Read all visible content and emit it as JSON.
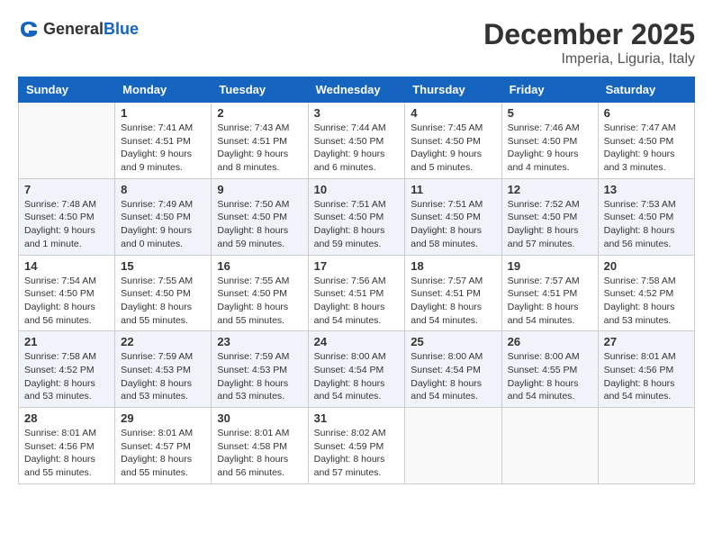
{
  "header": {
    "logo_general": "General",
    "logo_blue": "Blue",
    "month_title": "December 2025",
    "location": "Imperia, Liguria, Italy"
  },
  "columns": [
    "Sunday",
    "Monday",
    "Tuesday",
    "Wednesday",
    "Thursday",
    "Friday",
    "Saturday"
  ],
  "weeks": [
    [
      {
        "day": "",
        "info": ""
      },
      {
        "day": "1",
        "info": "Sunrise: 7:41 AM\nSunset: 4:51 PM\nDaylight: 9 hours\nand 9 minutes."
      },
      {
        "day": "2",
        "info": "Sunrise: 7:43 AM\nSunset: 4:51 PM\nDaylight: 9 hours\nand 8 minutes."
      },
      {
        "day": "3",
        "info": "Sunrise: 7:44 AM\nSunset: 4:50 PM\nDaylight: 9 hours\nand 6 minutes."
      },
      {
        "day": "4",
        "info": "Sunrise: 7:45 AM\nSunset: 4:50 PM\nDaylight: 9 hours\nand 5 minutes."
      },
      {
        "day": "5",
        "info": "Sunrise: 7:46 AM\nSunset: 4:50 PM\nDaylight: 9 hours\nand 4 minutes."
      },
      {
        "day": "6",
        "info": "Sunrise: 7:47 AM\nSunset: 4:50 PM\nDaylight: 9 hours\nand 3 minutes."
      }
    ],
    [
      {
        "day": "7",
        "info": "Sunrise: 7:48 AM\nSunset: 4:50 PM\nDaylight: 9 hours\nand 1 minute."
      },
      {
        "day": "8",
        "info": "Sunrise: 7:49 AM\nSunset: 4:50 PM\nDaylight: 9 hours\nand 0 minutes."
      },
      {
        "day": "9",
        "info": "Sunrise: 7:50 AM\nSunset: 4:50 PM\nDaylight: 8 hours\nand 59 minutes."
      },
      {
        "day": "10",
        "info": "Sunrise: 7:51 AM\nSunset: 4:50 PM\nDaylight: 8 hours\nand 59 minutes."
      },
      {
        "day": "11",
        "info": "Sunrise: 7:51 AM\nSunset: 4:50 PM\nDaylight: 8 hours\nand 58 minutes."
      },
      {
        "day": "12",
        "info": "Sunrise: 7:52 AM\nSunset: 4:50 PM\nDaylight: 8 hours\nand 57 minutes."
      },
      {
        "day": "13",
        "info": "Sunrise: 7:53 AM\nSunset: 4:50 PM\nDaylight: 8 hours\nand 56 minutes."
      }
    ],
    [
      {
        "day": "14",
        "info": "Sunrise: 7:54 AM\nSunset: 4:50 PM\nDaylight: 8 hours\nand 56 minutes."
      },
      {
        "day": "15",
        "info": "Sunrise: 7:55 AM\nSunset: 4:50 PM\nDaylight: 8 hours\nand 55 minutes."
      },
      {
        "day": "16",
        "info": "Sunrise: 7:55 AM\nSunset: 4:50 PM\nDaylight: 8 hours\nand 55 minutes."
      },
      {
        "day": "17",
        "info": "Sunrise: 7:56 AM\nSunset: 4:51 PM\nDaylight: 8 hours\nand 54 minutes."
      },
      {
        "day": "18",
        "info": "Sunrise: 7:57 AM\nSunset: 4:51 PM\nDaylight: 8 hours\nand 54 minutes."
      },
      {
        "day": "19",
        "info": "Sunrise: 7:57 AM\nSunset: 4:51 PM\nDaylight: 8 hours\nand 54 minutes."
      },
      {
        "day": "20",
        "info": "Sunrise: 7:58 AM\nSunset: 4:52 PM\nDaylight: 8 hours\nand 53 minutes."
      }
    ],
    [
      {
        "day": "21",
        "info": "Sunrise: 7:58 AM\nSunset: 4:52 PM\nDaylight: 8 hours\nand 53 minutes."
      },
      {
        "day": "22",
        "info": "Sunrise: 7:59 AM\nSunset: 4:53 PM\nDaylight: 8 hours\nand 53 minutes."
      },
      {
        "day": "23",
        "info": "Sunrise: 7:59 AM\nSunset: 4:53 PM\nDaylight: 8 hours\nand 53 minutes."
      },
      {
        "day": "24",
        "info": "Sunrise: 8:00 AM\nSunset: 4:54 PM\nDaylight: 8 hours\nand 54 minutes."
      },
      {
        "day": "25",
        "info": "Sunrise: 8:00 AM\nSunset: 4:54 PM\nDaylight: 8 hours\nand 54 minutes."
      },
      {
        "day": "26",
        "info": "Sunrise: 8:00 AM\nSunset: 4:55 PM\nDaylight: 8 hours\nand 54 minutes."
      },
      {
        "day": "27",
        "info": "Sunrise: 8:01 AM\nSunset: 4:56 PM\nDaylight: 8 hours\nand 54 minutes."
      }
    ],
    [
      {
        "day": "28",
        "info": "Sunrise: 8:01 AM\nSunset: 4:56 PM\nDaylight: 8 hours\nand 55 minutes."
      },
      {
        "day": "29",
        "info": "Sunrise: 8:01 AM\nSunset: 4:57 PM\nDaylight: 8 hours\nand 55 minutes."
      },
      {
        "day": "30",
        "info": "Sunrise: 8:01 AM\nSunset: 4:58 PM\nDaylight: 8 hours\nand 56 minutes."
      },
      {
        "day": "31",
        "info": "Sunrise: 8:02 AM\nSunset: 4:59 PM\nDaylight: 8 hours\nand 57 minutes."
      },
      {
        "day": "",
        "info": ""
      },
      {
        "day": "",
        "info": ""
      },
      {
        "day": "",
        "info": ""
      }
    ]
  ]
}
